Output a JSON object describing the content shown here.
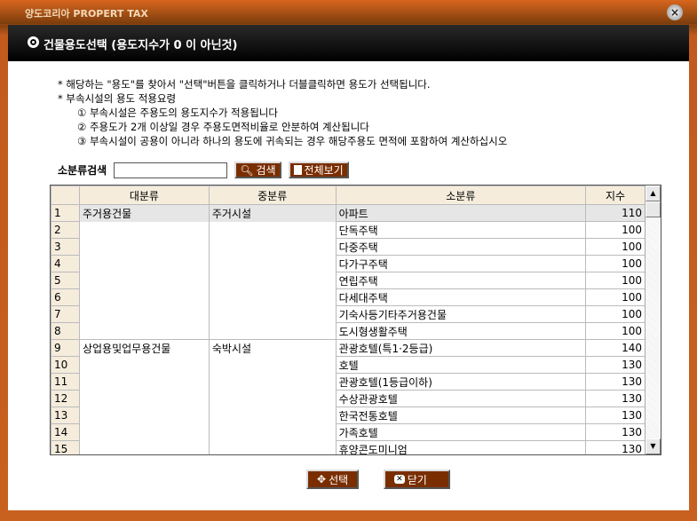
{
  "window": {
    "title": "양도코리아 PROPERT TAX",
    "close_icon": "×"
  },
  "header": {
    "title": "건물용도선택 (용도지수가 0 이 아닌것)"
  },
  "notes": [
    "* 해당하는 \"용도\"를 찾아서 \"선택\"버튼을 클릭하거나 더블클릭하면 용도가 선택됩니다.",
    "* 부속시설의 용도 적용요령",
    "① 부속시설은 주용도의 용도지수가 적용됩니다",
    "② 주용도가 2개 이상일 경우 주용도면적비율로 안분하여 계산됩니다",
    "③ 부속시설이 공용이 아니라 하나의 용도에 귀속되는 경우 해당주용도 면적에 포함하여 계산하십시오"
  ],
  "search": {
    "label": "소분류검색",
    "value": "",
    "search_button": "검색",
    "view_all_button": "전체보기"
  },
  "table": {
    "columns": [
      "",
      "대분류",
      "중분류",
      "소분류",
      "지수"
    ],
    "rows": [
      [
        "1",
        "주거용건물",
        "주거시설",
        "아파트",
        "110"
      ],
      [
        "2",
        "",
        "",
        "단독주택",
        "100"
      ],
      [
        "3",
        "",
        "",
        "다중주택",
        "100"
      ],
      [
        "4",
        "",
        "",
        "다가구주택",
        "100"
      ],
      [
        "5",
        "",
        "",
        "연립주택",
        "100"
      ],
      [
        "6",
        "",
        "",
        "다세대주택",
        "100"
      ],
      [
        "7",
        "",
        "",
        "기숙사등기타주거용건물",
        "100"
      ],
      [
        "8",
        "",
        "",
        "도시형생활주택",
        "100"
      ],
      [
        "9",
        "상업용및업무용건물",
        "숙박시설",
        "관광호텔(특1·2등급)",
        "140"
      ],
      [
        "10",
        "",
        "",
        "호텔",
        "130"
      ],
      [
        "11",
        "",
        "",
        "관광호텔(1등급이하)",
        "130"
      ],
      [
        "12",
        "",
        "",
        "수상관광호텔",
        "130"
      ],
      [
        "13",
        "",
        "",
        "한국전통호텔",
        "130"
      ],
      [
        "14",
        "",
        "",
        "가족호텔",
        "130"
      ],
      [
        "15",
        "",
        "",
        "휴양콘도미니엄",
        "130"
      ]
    ]
  },
  "buttons": {
    "select": "선택",
    "close": "닫기"
  }
}
